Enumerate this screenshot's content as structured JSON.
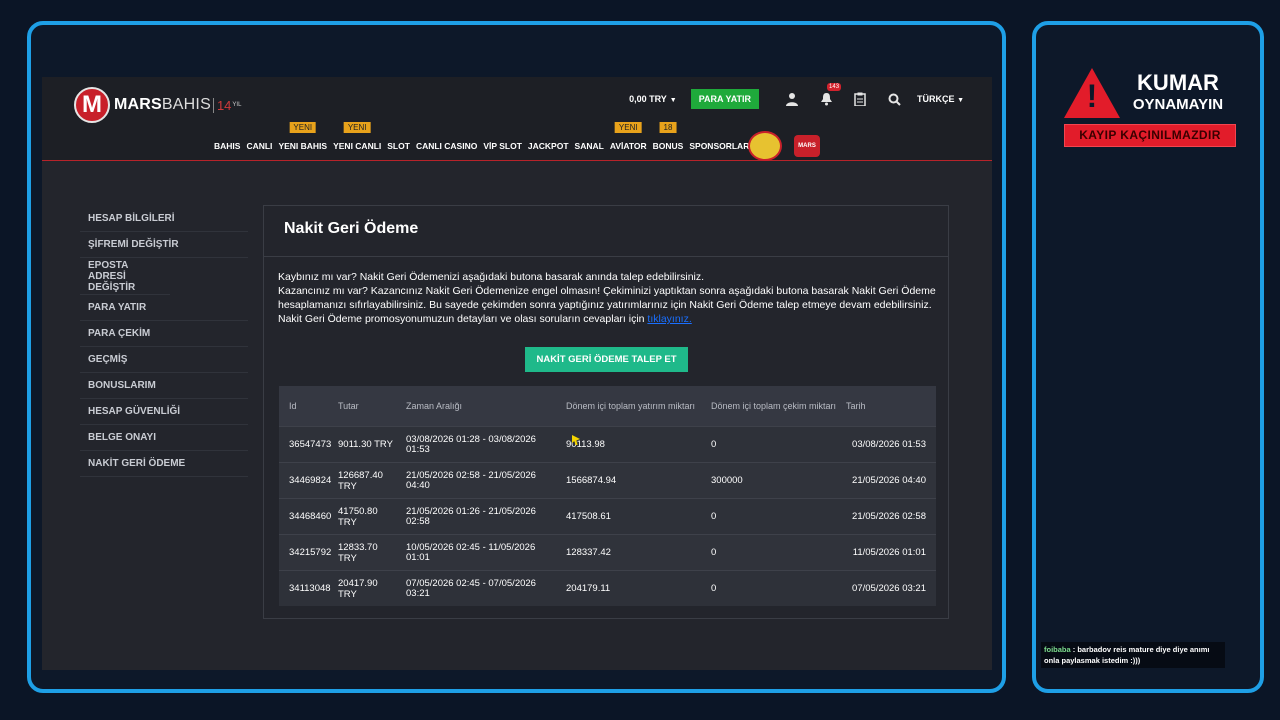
{
  "header": {
    "logo_mars": "MARS",
    "logo_bahis": "BAHIS",
    "logo_years": "14",
    "logo_yil": "YIL",
    "balance": "0,00 TRY",
    "deposit_button": "PARA YATIR",
    "notifications_count": "143",
    "language": "TÜRKÇE"
  },
  "nav": [
    {
      "label": "BAHIS",
      "badge": ""
    },
    {
      "label": "CANLI",
      "badge": ""
    },
    {
      "label": "YENI BAHIS",
      "badge": "YENI"
    },
    {
      "label": "YENI CANLI",
      "badge": "YENI"
    },
    {
      "label": "SLOT",
      "badge": ""
    },
    {
      "label": "CANLI CASINO",
      "badge": ""
    },
    {
      "label": "VİP SLOT",
      "badge": ""
    },
    {
      "label": "JACKPOT",
      "badge": ""
    },
    {
      "label": "SANAL",
      "badge": ""
    },
    {
      "label": "AVİATOR",
      "badge": "YENI"
    },
    {
      "label": "BONUS",
      "badge": "18"
    },
    {
      "label": "SPONSORLAR",
      "badge": ""
    }
  ],
  "promo_tv_label": "MARS",
  "sidebar": {
    "items": [
      {
        "label": "HESAP BİLGİLERİ"
      },
      {
        "label": "ŞİFREMİ DEĞİŞTİR"
      },
      {
        "label": "EPOSTA ADRESİ DEĞİŞTİR"
      },
      {
        "label": "PARA YATIR"
      },
      {
        "label": "PARA ÇEKİM"
      },
      {
        "label": "GEÇMİŞ"
      },
      {
        "label": "BONUSLARIM"
      },
      {
        "label": "HESAP GÜVENLİĞİ"
      },
      {
        "label": "BELGE ONAYI"
      },
      {
        "label": "NAKİT GERİ ÖDEME"
      }
    ]
  },
  "panel": {
    "title": "Nakit Geri Ödeme",
    "line1": "Kaybınız mı var? Nakit Geri Ödemenizi aşağıdaki butona basarak anında talep edebilirsiniz.",
    "line2": "Kazancınız mı var? Kazancınız Nakit Geri Ödemenize engel olmasın! Çekiminizi yaptıktan sonra aşağıdaki butona basarak Nakit Geri Ödeme hesaplamanızı sıfırlayabilirsiniz. Bu sayede çekimden sonra yaptığınız yatırımlarınız için Nakit Geri Ödeme talep etmeye devam edebilirsiniz.",
    "line3": "Nakit Geri Ödeme promosyonumuzun detayları ve olası soruların cevapları için",
    "link": "tıklayınız.",
    "claim_button": "NAKİT GERİ ÖDEME TALEP ET"
  },
  "table": {
    "headers": [
      "Id",
      "Tutar",
      "Zaman Aralığı",
      "Dönem içi toplam yatırım miktarı",
      "Dönem içi toplam çekim miktarı",
      "Tarih"
    ],
    "rows": [
      [
        "36547473",
        "9011.30 TRY",
        "03/08/2026 01:28 - 03/08/2026 01:53",
        "90113.98",
        "0",
        "03/08/2026 01:53"
      ],
      [
        "34469824",
        "126687.40 TRY",
        "21/05/2026 02:58 - 21/05/2026 04:40",
        "1566874.94",
        "300000",
        "21/05/2026 04:40"
      ],
      [
        "34468460",
        "41750.80 TRY",
        "21/05/2026 01:26 - 21/05/2026 02:58",
        "417508.61",
        "0",
        "21/05/2026 02:58"
      ],
      [
        "34215792",
        "12833.70 TRY",
        "10/05/2026 02:45 - 11/05/2026 01:01",
        "128337.42",
        "0",
        "11/05/2026 01:01"
      ],
      [
        "34113048",
        "20417.90 TRY",
        "07/05/2026 02:45 - 07/05/2026 03:21",
        "204179.11",
        "0",
        "07/05/2026 03:21"
      ]
    ]
  },
  "side": {
    "title1": "KUMAR",
    "title2": "OYNAMAYIN",
    "warning": "KAYIP KAÇINILMAZDIR",
    "chat_user": "foibaba",
    "chat_message": ": barbadov reis mature diye diye anımı onla paylasmak istedim :)))"
  },
  "colors": {
    "accent": "#1e9fe6",
    "brand_red": "#c8202a",
    "deposit_green": "#1faa3b",
    "claim_green": "#1fb98a"
  }
}
